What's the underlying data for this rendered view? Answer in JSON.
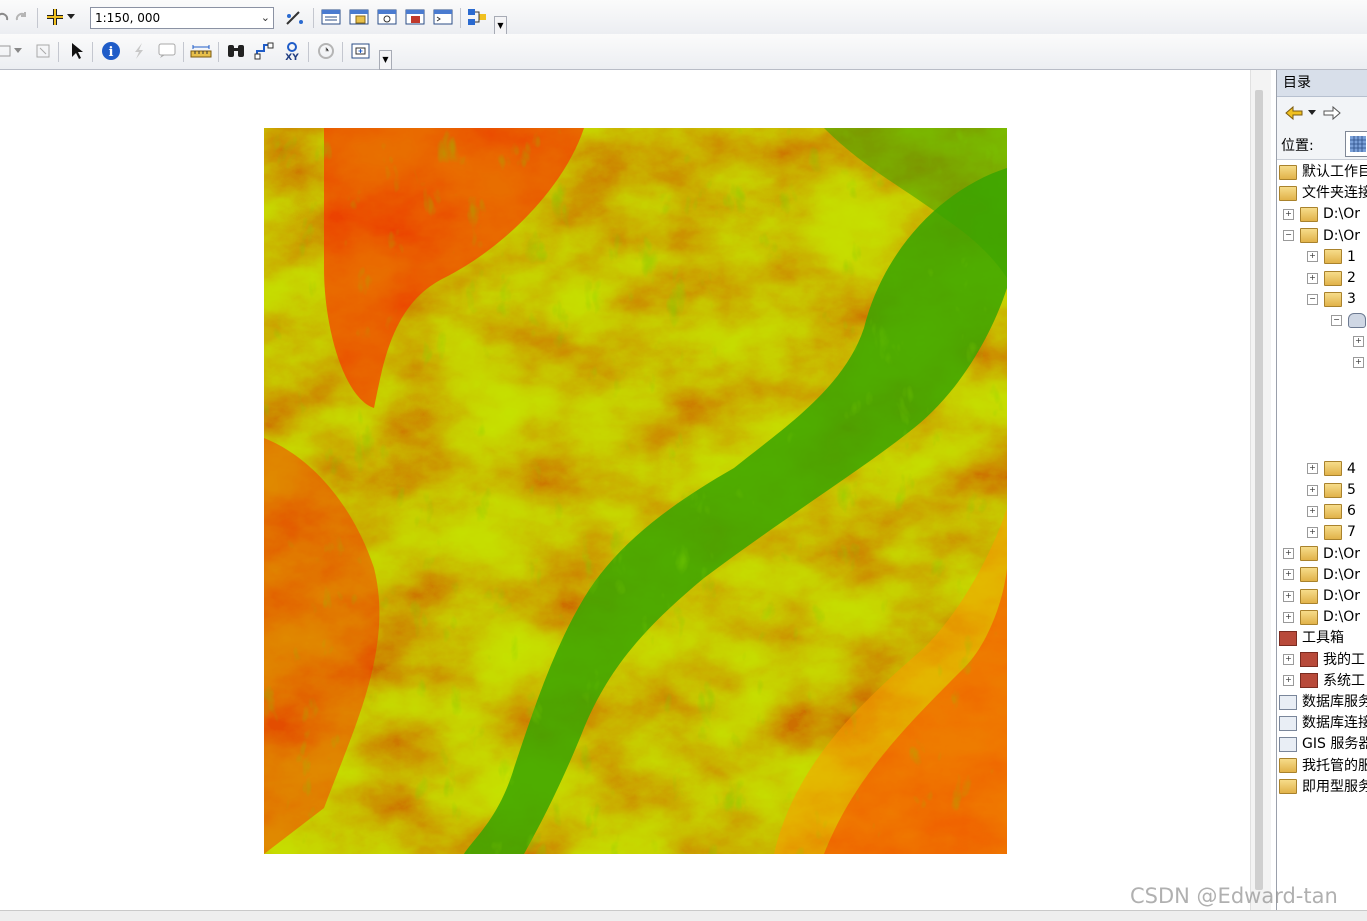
{
  "toolbar": {
    "scale_value": "1:150, 000"
  },
  "catalog": {
    "title": "目录",
    "location_label": "位置:",
    "tree": [
      {
        "label": "默认工作目录",
        "depth": 0,
        "expander": "",
        "icon": "home-folder-icon"
      },
      {
        "label": "文件夹连接",
        "depth": 0,
        "expander": "",
        "icon": "folder-connections-icon"
      },
      {
        "label": "D:\\Or",
        "depth": 1,
        "expander": "+",
        "icon": "folder-icon"
      },
      {
        "label": "D:\\Or",
        "depth": 1,
        "expander": "−",
        "icon": "folder-icon"
      },
      {
        "label": "1",
        "depth": 2,
        "expander": "+",
        "icon": "folder-icon"
      },
      {
        "label": "2",
        "depth": 2,
        "expander": "+",
        "icon": "folder-icon"
      },
      {
        "label": "3",
        "depth": 2,
        "expander": "−",
        "icon": "folder-icon"
      },
      {
        "label": "",
        "depth": 3,
        "expander": "−",
        "icon": "geodatabase-icon"
      },
      {
        "label": "",
        "depth": 4,
        "expander": "+",
        "icon": ""
      },
      {
        "label": "",
        "depth": 4,
        "expander": "+",
        "icon": ""
      },
      {
        "label": "",
        "depth": 4,
        "expander": "",
        "icon": "point-feature-class-icon"
      },
      {
        "label": "",
        "depth": 4,
        "expander": "",
        "icon": "point-feature-class-icon"
      },
      {
        "label": "",
        "depth": 4,
        "expander": "",
        "icon": "line-feature-class-icon"
      },
      {
        "label": "",
        "depth": 4,
        "expander": "",
        "icon": "point-feature-class-icon"
      },
      {
        "label": "4",
        "depth": 2,
        "expander": "+",
        "icon": "folder-icon"
      },
      {
        "label": "5",
        "depth": 2,
        "expander": "+",
        "icon": "folder-icon"
      },
      {
        "label": "6",
        "depth": 2,
        "expander": "+",
        "icon": "folder-icon"
      },
      {
        "label": "7",
        "depth": 2,
        "expander": "+",
        "icon": "folder-icon"
      },
      {
        "label": "D:\\Or",
        "depth": 1,
        "expander": "+",
        "icon": "folder-icon"
      },
      {
        "label": "D:\\Or",
        "depth": 1,
        "expander": "+",
        "icon": "folder-icon"
      },
      {
        "label": "D:\\Or",
        "depth": 1,
        "expander": "+",
        "icon": "folder-icon"
      },
      {
        "label": "D:\\Or",
        "depth": 1,
        "expander": "+",
        "icon": "folder-icon"
      },
      {
        "label": "工具箱",
        "depth": 0,
        "expander": "",
        "icon": "toolbox-icon"
      },
      {
        "label": "我的工",
        "depth": 1,
        "expander": "+",
        "icon": "toolbox-icon"
      },
      {
        "label": "系统工",
        "depth": 1,
        "expander": "+",
        "icon": "toolbox-icon"
      },
      {
        "label": "数据库服务",
        "depth": 0,
        "expander": "",
        "icon": "database-server-icon"
      },
      {
        "label": "数据库连接",
        "depth": 0,
        "expander": "",
        "icon": "database-connection-icon"
      },
      {
        "label": "GIS 服务器",
        "depth": 0,
        "expander": "",
        "icon": "gis-server-icon"
      },
      {
        "label": "我托管的服务",
        "depth": 0,
        "expander": "",
        "icon": "hosted-services-icon"
      },
      {
        "label": "即用型服务",
        "depth": 0,
        "expander": "",
        "icon": "ready-services-icon"
      }
    ]
  },
  "map": {
    "colors": {
      "low": "#3aa400",
      "mid_low": "#8fcf00",
      "mid": "#f2f200",
      "mid_high": "#ff9a00",
      "high": "#ff2400"
    }
  },
  "watermark": "CSDN @Edward-tan"
}
